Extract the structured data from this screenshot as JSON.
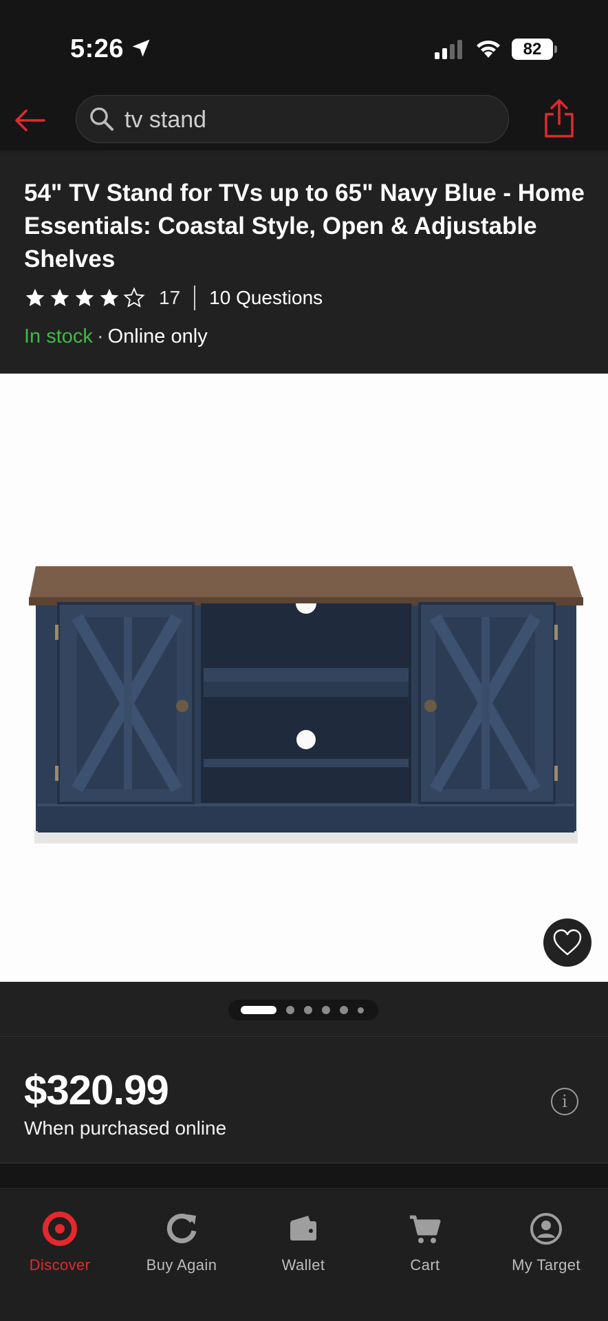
{
  "status_bar": {
    "time": "5:26",
    "battery": "82"
  },
  "search": {
    "query": "tv stand"
  },
  "product": {
    "title": "54\" TV Stand for TVs up to 65\" Navy Blue - Home Essentials: Coastal Style, Open & Adjustable Shelves",
    "rating_stars": 4,
    "rating_count": "17",
    "questions": "10 Questions",
    "stock_status": "In stock",
    "stock_separator": "·",
    "availability": "Online only",
    "price": "$320.99",
    "price_note": "When purchased online",
    "image_count": 6,
    "active_image": 1
  },
  "colors": {
    "accent": "#e3282e",
    "in_stock": "#3fba46",
    "surface": "#212121",
    "background": "#151515"
  },
  "nav": {
    "items": [
      {
        "label": "Discover",
        "icon": "target-icon",
        "active": true
      },
      {
        "label": "Buy Again",
        "icon": "refresh-icon",
        "active": false
      },
      {
        "label": "Wallet",
        "icon": "wallet-icon",
        "active": false
      },
      {
        "label": "Cart",
        "icon": "cart-icon",
        "active": false
      },
      {
        "label": "My Target",
        "icon": "user-icon",
        "active": false
      }
    ]
  }
}
